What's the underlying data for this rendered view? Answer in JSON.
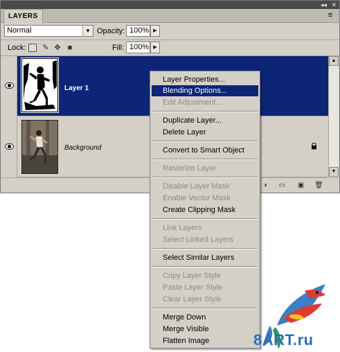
{
  "panel": {
    "title_collapse": "◂◂",
    "title_close": "✕",
    "tab_label": "LAYERS",
    "tab_menu_icon": "≡",
    "blend_mode": "Normal",
    "opacity_label": "Opacity:",
    "opacity_value": "100%",
    "lock_label": "Lock:",
    "fill_label": "Fill:",
    "fill_value": "100%"
  },
  "layers": [
    {
      "name": "Layer 1",
      "selected": true,
      "visible": true,
      "thumb": "mask"
    },
    {
      "name": "Background",
      "selected": false,
      "visible": true,
      "locked": true,
      "thumb": "photo"
    }
  ],
  "context_menu": {
    "items": [
      {
        "label": "Layer Properties...",
        "enabled": true
      },
      {
        "label": "Blending Options...",
        "enabled": true,
        "highlighted": true
      },
      {
        "label": "Edit Adjustment...",
        "enabled": false
      },
      {
        "label": "Duplicate Layer...",
        "enabled": true
      },
      {
        "label": "Delete Layer",
        "enabled": true
      },
      {
        "label": "Convert to Smart Object",
        "enabled": true
      },
      {
        "label": "Rasterize Layer",
        "enabled": false
      },
      {
        "label": "Disable Layer Mask",
        "enabled": false
      },
      {
        "label": "Enable Vector Mask",
        "enabled": false
      },
      {
        "label": "Create Clipping Mask",
        "enabled": true
      },
      {
        "label": "Link Layers",
        "enabled": false
      },
      {
        "label": "Select Linked Layers",
        "enabled": false
      },
      {
        "label": "Select Similar Layers",
        "enabled": true
      },
      {
        "label": "Copy Layer Style",
        "enabled": false
      },
      {
        "label": "Paste Layer Style",
        "enabled": false
      },
      {
        "label": "Clear Layer Style",
        "enabled": false
      },
      {
        "label": "Merge Down",
        "enabled": true
      },
      {
        "label": "Merge Visible",
        "enabled": true
      },
      {
        "label": "Flatten Image",
        "enabled": true
      }
    ]
  },
  "watermark": {
    "text": "8ART.ru"
  },
  "colors": {
    "selection": "#0c2577",
    "panel_bg": "#d4d0c8",
    "disabled_text": "#8e8b84"
  }
}
